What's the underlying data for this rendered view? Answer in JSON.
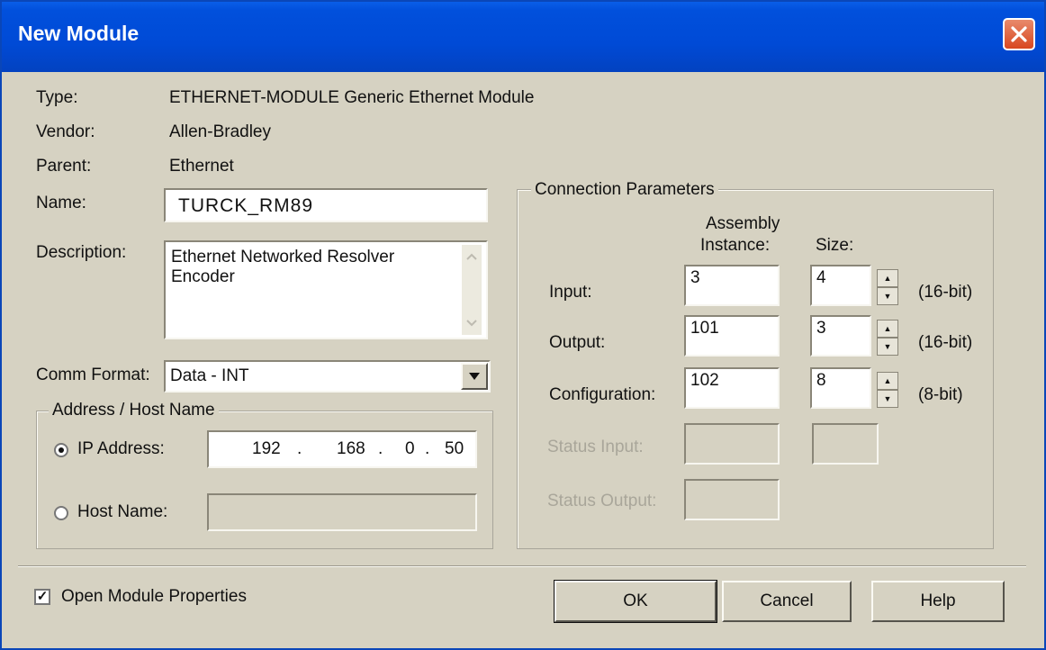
{
  "window": {
    "title": "New Module"
  },
  "info": {
    "type_label": "Type:",
    "type_value": "ETHERNET-MODULE Generic Ethernet Module",
    "vendor_label": "Vendor:",
    "vendor_value": "Allen-Bradley",
    "parent_label": "Parent:",
    "parent_value": "Ethernet"
  },
  "name": {
    "label": "Name:",
    "value": "TURCK_RM89"
  },
  "description": {
    "label": "Description:",
    "line1": "Ethernet Networked Resolver",
    "line2": "Encoder"
  },
  "comm_format": {
    "label": "Comm Format:",
    "value": "Data - INT"
  },
  "address": {
    "legend": "Address / Host Name",
    "ip_label": "IP Address:",
    "ip_1": "192",
    "ip_2": "168",
    "ip_3": "0",
    "ip_4": "50",
    "ip_selected": true,
    "host_label": "Host Name:",
    "host_value": ""
  },
  "connection": {
    "legend": "Connection Parameters",
    "assembly_header_1": "Assembly",
    "assembly_header_2": "Instance:",
    "size_header": "Size:",
    "rows": [
      {
        "label": "Input:",
        "instance": "3",
        "size": "4",
        "unit": "(16-bit)"
      },
      {
        "label": "Output:",
        "instance": "101",
        "size": "3",
        "unit": "(16-bit)"
      },
      {
        "label": "Configuration:",
        "instance": "102",
        "size": "8",
        "unit": "(8-bit)"
      }
    ],
    "status_input_label": "Status Input:",
    "status_output_label": "Status Output:"
  },
  "footer": {
    "open_props_label": "Open Module Properties",
    "open_props_checked": true,
    "ok": "OK",
    "cancel": "Cancel",
    "help": "Help"
  },
  "colors": {
    "titlebar": "#004ad6",
    "face": "#d6d2c2",
    "close": "#d8471f"
  },
  "icons": {
    "close": "close-icon",
    "dropdown": "chevron-down-icon",
    "spin_up": "chevron-up-icon",
    "spin_down": "chevron-down-icon"
  }
}
